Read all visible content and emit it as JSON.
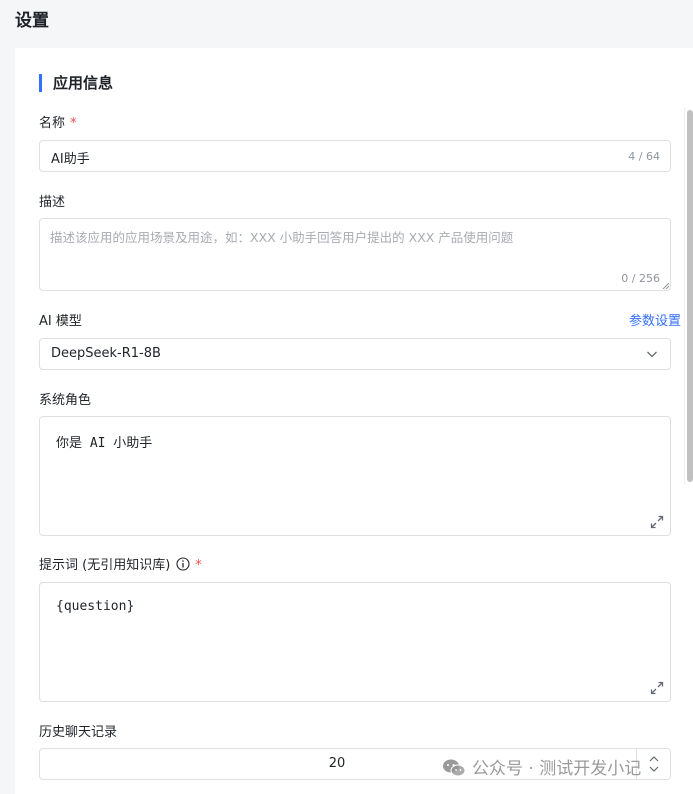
{
  "page": {
    "title": "设置"
  },
  "section": {
    "title": "应用信息"
  },
  "name_field": {
    "label": "名称",
    "required_mark": "*",
    "value": "AI助手",
    "counter": "4 / 64"
  },
  "description_field": {
    "label": "描述",
    "placeholder": "描述该应用的应用场景及用途，如：XXX 小助手回答用户提出的 XXX 产品使用问题",
    "counter": "0 / 256"
  },
  "model_field": {
    "label": "AI 模型",
    "settings_link": "参数设置",
    "selected": "DeepSeek-R1-8B"
  },
  "system_role_field": {
    "label": "系统角色",
    "value": "你是 AI 小助手"
  },
  "prompt_field": {
    "label": "提示词 (无引用知识库)",
    "required_mark": "*",
    "value": "{question}"
  },
  "history_field": {
    "label": "历史聊天记录",
    "value": "20"
  },
  "watermark": {
    "text": "公众号 · 测试开发小记"
  },
  "icons": {
    "expand": "expand-icon",
    "chevron": "chevron-down-icon",
    "info": "info-icon",
    "stepper": "stepper-arrows-icon",
    "wechat": "wechat-icon"
  },
  "colors": {
    "accent": "#3370ff",
    "required": "#f54a45",
    "border": "#dee0e3",
    "background": "#f5f6f7"
  }
}
